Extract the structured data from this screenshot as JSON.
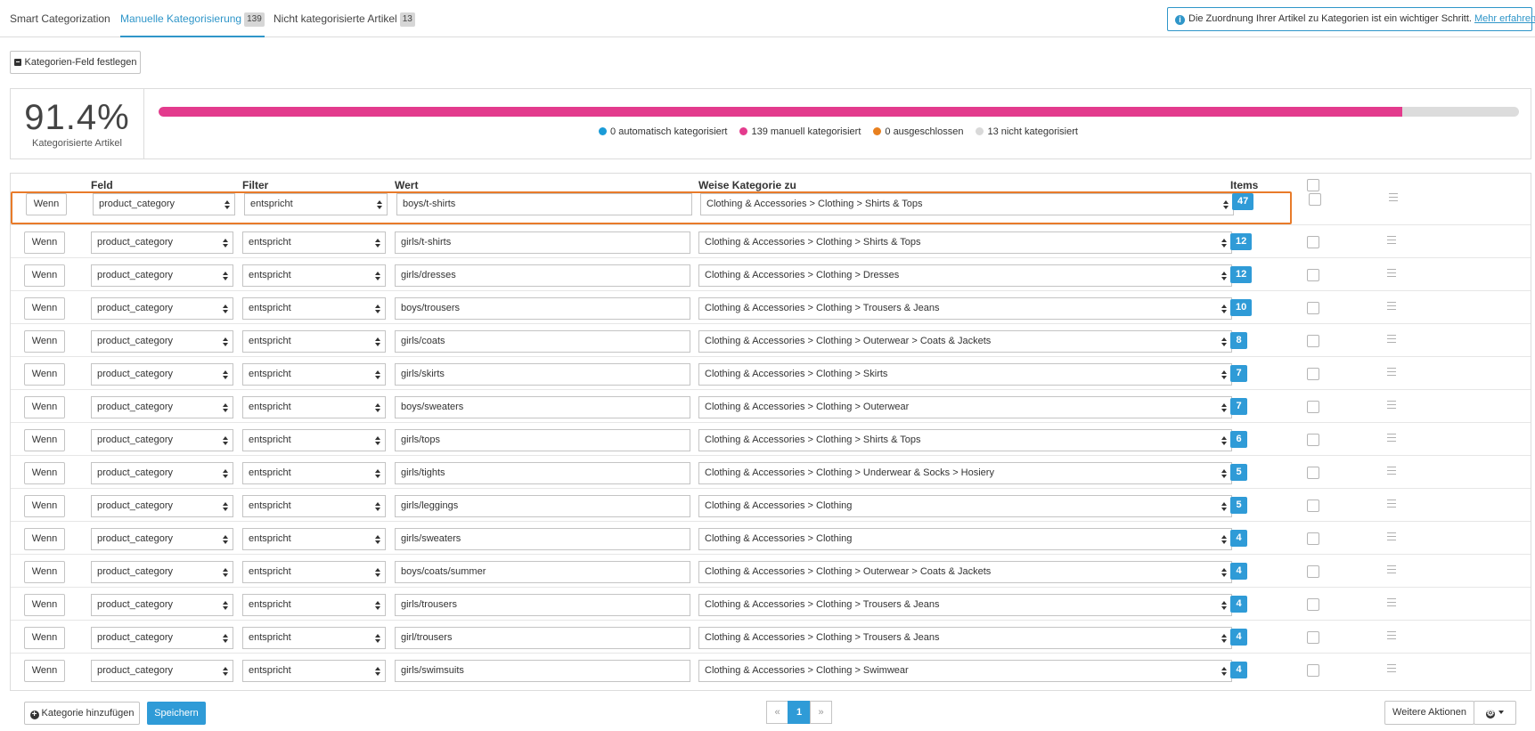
{
  "tabs": [
    {
      "label": "Smart Categorization"
    },
    {
      "label": "Manuelle Kategorisierung",
      "count": "139"
    },
    {
      "label": "Nicht kategorisierte Artikel",
      "count": "13"
    }
  ],
  "notice": {
    "text": "Die Zuordnung Ihrer Artikel zu Kategorien ist ein wichtiger Schritt.",
    "link": "Mehr erfahren",
    "tail": "."
  },
  "toolbar": {
    "set_field_label": "Kategorien-Feld festlegen"
  },
  "progress": {
    "percent_text": "91.4%",
    "percent_value": 91.4,
    "label": "Kategorisierte Artikel",
    "legend": [
      {
        "text": "0 automatisch kategorisiert",
        "color": "#1a9bd7"
      },
      {
        "text": "139 manuell kategorisiert",
        "color": "#e33b8d"
      },
      {
        "text": "0 ausgeschlossen",
        "color": "#e8801f"
      },
      {
        "text": "13 nicht kategorisiert",
        "color": "#d9d9d9"
      }
    ]
  },
  "table": {
    "headers": {
      "feld": "Feld",
      "filter": "Filter",
      "wert": "Wert",
      "kategorie": "Weise Kategorie zu",
      "items": "Items"
    },
    "rows": [
      {
        "cond": "Wenn",
        "field": "product_category",
        "filter": "entspricht",
        "value": "boys/t-shirts",
        "category": "Clothing & Accessories > Clothing > Shirts & Tops",
        "items": "47"
      },
      {
        "cond": "Wenn",
        "field": "product_category",
        "filter": "entspricht",
        "value": "girls/t-shirts",
        "category": "Clothing & Accessories > Clothing > Shirts & Tops",
        "items": "12"
      },
      {
        "cond": "Wenn",
        "field": "product_category",
        "filter": "entspricht",
        "value": "girls/dresses",
        "category": "Clothing & Accessories > Clothing > Dresses",
        "items": "12"
      },
      {
        "cond": "Wenn",
        "field": "product_category",
        "filter": "entspricht",
        "value": "boys/trousers",
        "category": "Clothing & Accessories > Clothing > Trousers & Jeans",
        "items": "10"
      },
      {
        "cond": "Wenn",
        "field": "product_category",
        "filter": "entspricht",
        "value": "girls/coats",
        "category": "Clothing & Accessories > Clothing > Outerwear > Coats & Jackets",
        "items": "8"
      },
      {
        "cond": "Wenn",
        "field": "product_category",
        "filter": "entspricht",
        "value": "girls/skirts",
        "category": "Clothing & Accessories > Clothing > Skirts",
        "items": "7"
      },
      {
        "cond": "Wenn",
        "field": "product_category",
        "filter": "entspricht",
        "value": "boys/sweaters",
        "category": "Clothing & Accessories > Clothing > Outerwear",
        "items": "7"
      },
      {
        "cond": "Wenn",
        "field": "product_category",
        "filter": "entspricht",
        "value": "girls/tops",
        "category": "Clothing & Accessories > Clothing > Shirts & Tops",
        "items": "6"
      },
      {
        "cond": "Wenn",
        "field": "product_category",
        "filter": "entspricht",
        "value": "girls/tights",
        "category": "Clothing & Accessories > Clothing > Underwear & Socks > Hosiery",
        "items": "5"
      },
      {
        "cond": "Wenn",
        "field": "product_category",
        "filter": "entspricht",
        "value": "girls/leggings",
        "category": "Clothing & Accessories > Clothing",
        "items": "5"
      },
      {
        "cond": "Wenn",
        "field": "product_category",
        "filter": "entspricht",
        "value": "girls/sweaters",
        "category": "Clothing & Accessories > Clothing",
        "items": "4"
      },
      {
        "cond": "Wenn",
        "field": "product_category",
        "filter": "entspricht",
        "value": "boys/coats/summer",
        "category": "Clothing & Accessories > Clothing > Outerwear > Coats & Jackets",
        "items": "4"
      },
      {
        "cond": "Wenn",
        "field": "product_category",
        "filter": "entspricht",
        "value": "girls/trousers",
        "category": "Clothing & Accessories > Clothing > Trousers & Jeans",
        "items": "4"
      },
      {
        "cond": "Wenn",
        "field": "product_category",
        "filter": "entspricht",
        "value": "girl/trousers",
        "category": "Clothing & Accessories > Clothing > Trousers & Jeans",
        "items": "4"
      },
      {
        "cond": "Wenn",
        "field": "product_category",
        "filter": "entspricht",
        "value": "girls/swimsuits",
        "category": "Clothing & Accessories > Clothing > Swimwear",
        "items": "4"
      }
    ]
  },
  "footer": {
    "add_label": "Kategorie hinzufügen",
    "save_label": "Speichern",
    "pagination": {
      "prev": "«",
      "current": "1",
      "next": "»"
    },
    "more_actions_label": "Weitere Aktionen"
  },
  "colors": {
    "accent": "#2f9bd7",
    "highlight": "#e87b2a",
    "progress_fill": "#e33b8d",
    "progress_track": "#dcdcdc"
  }
}
